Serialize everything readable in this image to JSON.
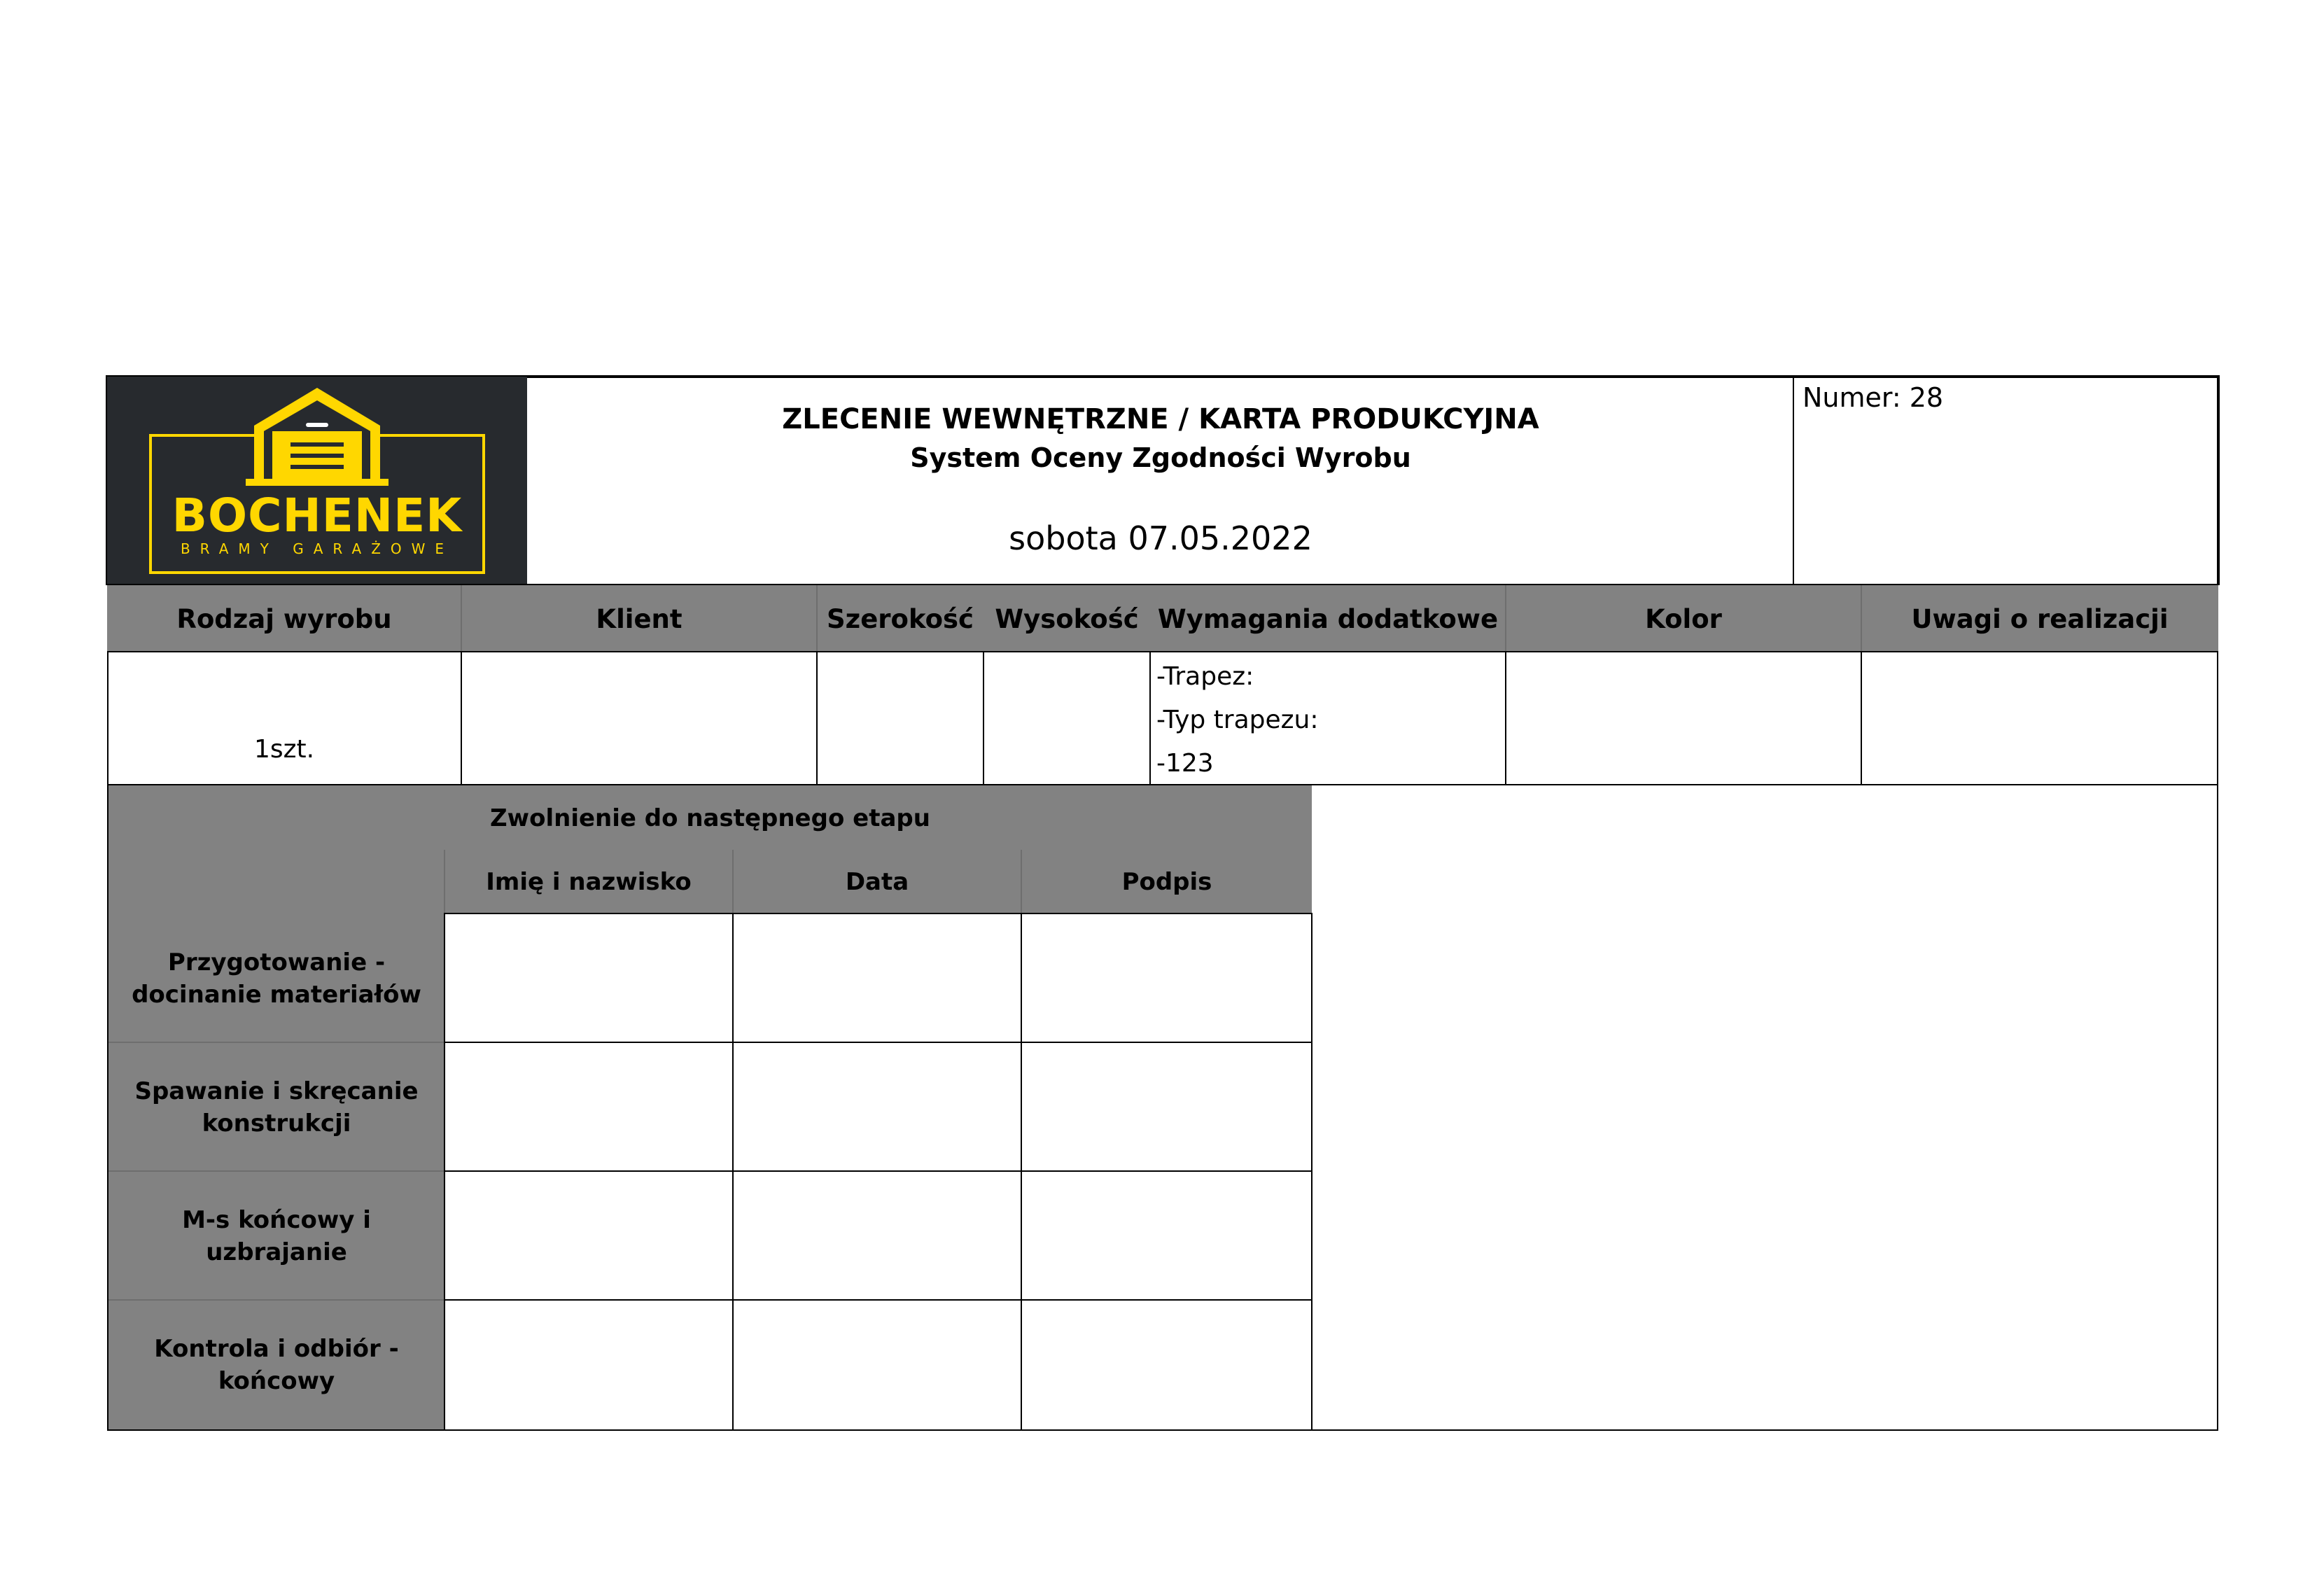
{
  "header": {
    "logo": {
      "brand": "BOCHENEK",
      "tagline": "BRAMY GARAŻOWE",
      "colors": {
        "background": "#272a2e",
        "accent": "#ffd700"
      },
      "icon": "garage-icon"
    },
    "title": "ZLECENIE WEWNĘTRZNE / KARTA PRODUKCYJNA",
    "subtitle": "System Oceny Zgodności Wyrobu",
    "date": "sobota 07.05.2022",
    "number_label": "Numer: 28"
  },
  "product_table": {
    "columns": [
      "Rodzaj wyrobu",
      "Klient",
      "Szerokość",
      "Wysokość",
      "Wymagania dodatkowe",
      "Kolor",
      "Uwagi o realizacji"
    ],
    "row": {
      "product_type": "1szt.",
      "client": "",
      "width": "",
      "height": "",
      "requirements": [
        "-Trapez:",
        "-Typ trapezu:",
        "-123"
      ],
      "color": "",
      "notes": ""
    }
  },
  "release_table": {
    "title": "Zwolnienie do następnego etapu",
    "columns": [
      "Imię i nazwisko",
      "Data",
      "Podpis"
    ],
    "stages": [
      "Przygotowanie - docinanie materiałów",
      "Spawanie i skręcanie konstrukcji",
      "M-s końcowy i uzbrajanie",
      "Kontrola i odbiór - końcowy"
    ]
  },
  "colors": {
    "header_gray": "#828282",
    "border": "#000000"
  }
}
